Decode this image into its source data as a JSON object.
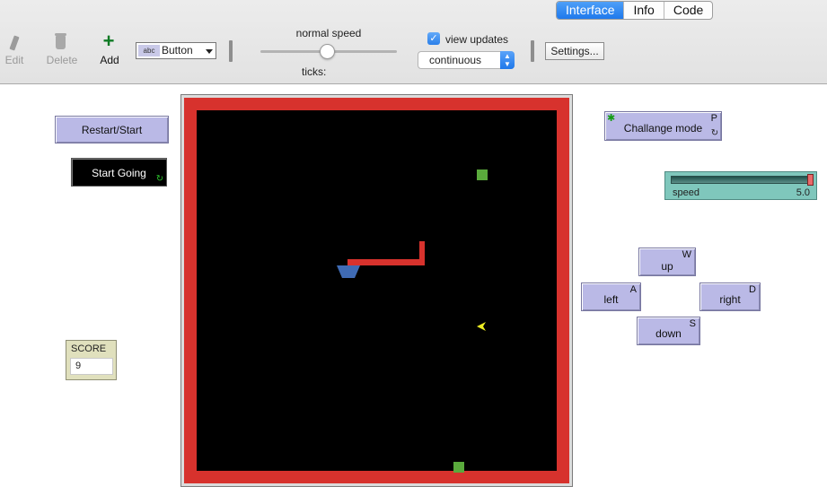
{
  "tabs": [
    {
      "label": "Interface",
      "active": true
    },
    {
      "label": "Info",
      "active": false
    },
    {
      "label": "Code",
      "active": false
    }
  ],
  "toolbar": {
    "edit_label": "Edit",
    "delete_label": "Delete",
    "add_label": "Add",
    "widget_type": "Button",
    "widget_icon_text": "abc",
    "speed_label": "normal speed",
    "ticks_label": "ticks:",
    "view_updates_label": "view updates",
    "view_updates_checked": true,
    "update_mode": "continuous",
    "settings_label": "Settings..."
  },
  "buttons": {
    "restart": {
      "label": "Restart/Start"
    },
    "start_going": {
      "label": "Start Going"
    },
    "challenge": {
      "label": "Challange mode",
      "key": "P"
    },
    "up": {
      "label": "up",
      "key": "W"
    },
    "left": {
      "label": "left",
      "key": "A"
    },
    "right": {
      "label": "right",
      "key": "D"
    },
    "down": {
      "label": "down",
      "key": "S"
    }
  },
  "score_monitor": {
    "name": "SCORE",
    "value": "9"
  },
  "speed_slider": {
    "name": "speed",
    "value": "5.0",
    "fraction": 1.0
  },
  "world": {
    "border_color": "#d7322d",
    "background": "#000000",
    "snake_color": "#d7322d",
    "food_color": "#5aaa3c",
    "head_color": "#3f6bb5",
    "arrow_color": "#eded23"
  },
  "icons": {
    "edit": "pencil-icon",
    "delete": "trash-icon",
    "add": "plus-icon",
    "forever": "forever-icon"
  }
}
